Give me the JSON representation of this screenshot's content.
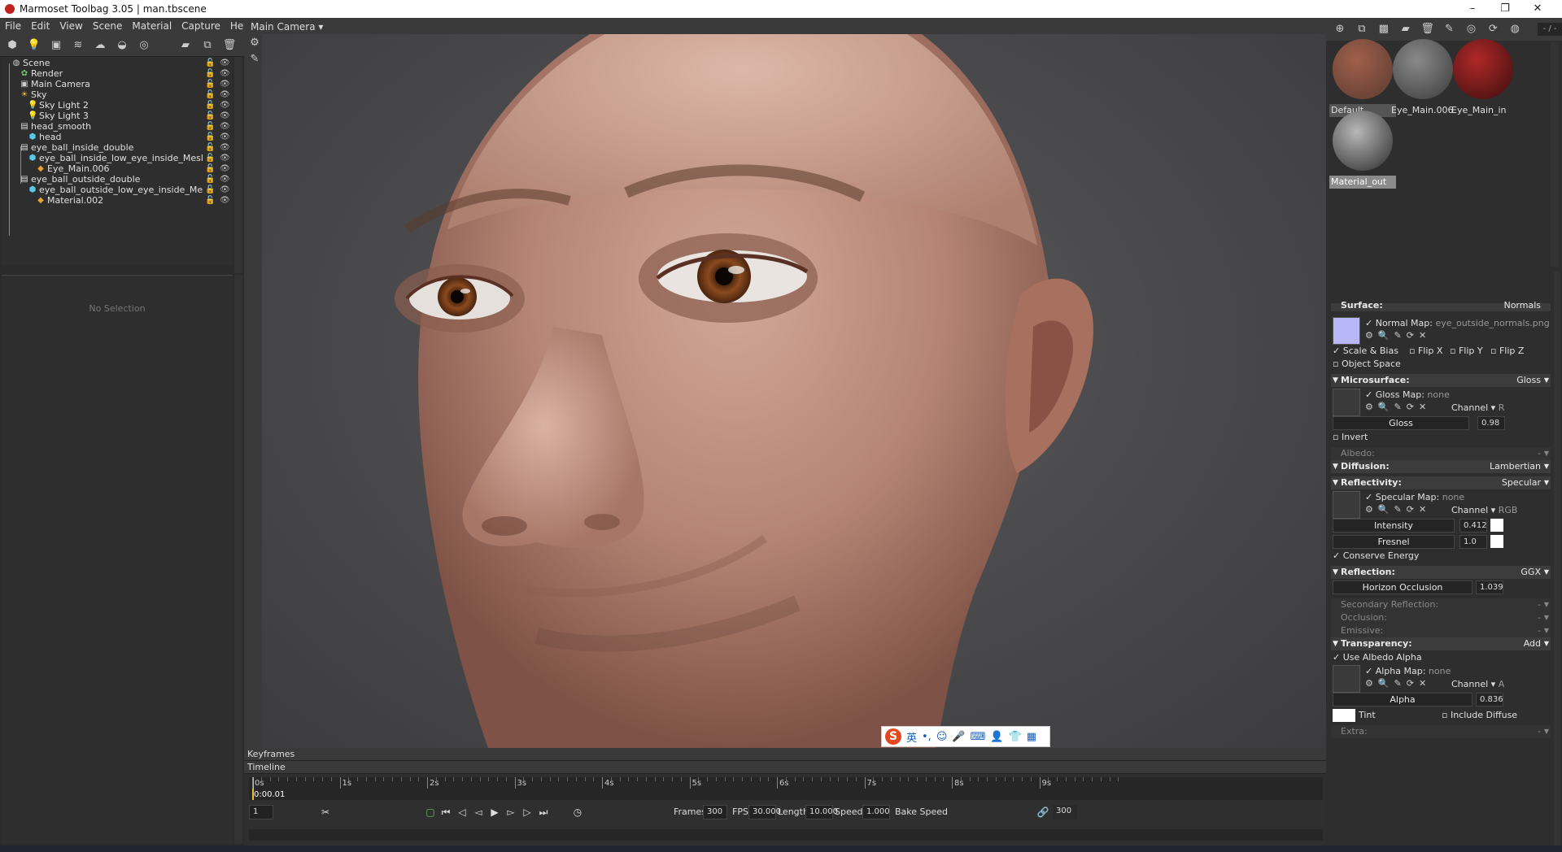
{
  "window": {
    "app_title": "Marmoset Toolbag 3.05  |  man.tbscene",
    "controls": [
      "–",
      "❐",
      "✕"
    ]
  },
  "menu": [
    "File",
    "Edit",
    "View",
    "Scene",
    "Material",
    "Capture",
    "Help"
  ],
  "scene_tree": [
    {
      "label": "Scene",
      "icon": "scene-icon",
      "depth": 0
    },
    {
      "label": "Render",
      "icon": "render-icon",
      "depth": 1
    },
    {
      "label": "Main Camera",
      "icon": "camera-icon",
      "depth": 1
    },
    {
      "label": "Sky",
      "icon": "sky-icon",
      "depth": 1
    },
    {
      "label": "Sky Light 2",
      "icon": "light-icon",
      "depth": 2
    },
    {
      "label": "Sky Light 3",
      "icon": "light-icon",
      "depth": 2
    },
    {
      "label": "head_smooth",
      "icon": "object-icon",
      "depth": 1
    },
    {
      "label": "head",
      "icon": "mesh-icon",
      "depth": 2
    },
    {
      "label": "eye_ball_inside_double",
      "icon": "object-icon",
      "depth": 1
    },
    {
      "label": "eye_ball_inside_low_eye_inside_Mesl",
      "icon": "mesh-icon",
      "depth": 2
    },
    {
      "label": "Eye_Main.006",
      "icon": "material-icon",
      "depth": 3
    },
    {
      "label": "eye_ball_outside_double",
      "icon": "object-icon",
      "depth": 1
    },
    {
      "label": "eye_ball_outside_low_eye_inside_Me",
      "icon": "mesh-icon",
      "depth": 2
    },
    {
      "label": "Material.002",
      "icon": "material-icon",
      "depth": 3
    }
  ],
  "left_panel": {
    "no_selection": "No Selection"
  },
  "viewport": {
    "camera_label": "Main Camera ▾"
  },
  "timeline": {
    "keyframes_label": "Keyframes",
    "timeline_label": "Timeline",
    "ticks": [
      "0s",
      "1s",
      "2s",
      "3s",
      "4s",
      "5s",
      "6s",
      "7s",
      "8s",
      "9s"
    ],
    "current_time": "0:00.01",
    "frame_field": "1",
    "frames_label": "Frames",
    "frames_value": "300",
    "fps_label": "FPS",
    "fps_value": "30.000",
    "length_label": "Length",
    "length_value": "10.000",
    "speed_label": "Speed",
    "speed_value": "1.000",
    "bake_speed": "Bake Speed",
    "end_frame": "300"
  },
  "right_panel": {
    "page_indicator": "- / -",
    "materials": [
      {
        "label": "Default",
        "colors": [
          "#a0604a",
          "#5a3a32"
        ]
      },
      {
        "label": "Eye_Main.006",
        "colors": [
          "#8a8a8a",
          "#3a3a3a"
        ]
      },
      {
        "label": "Eye_Main_in",
        "colors": [
          "#b02828",
          "#3a0e0e"
        ]
      },
      {
        "label": "Material_out",
        "colors": [
          "#b8b8b8",
          "#2a2a2a"
        ]
      }
    ],
    "sections": {
      "surface": {
        "name": "Surface:",
        "value": "Normals"
      },
      "normal_map_label": "Normal Map:",
      "normal_map_value": "eye_outside_normals.png",
      "scale_bias": "Scale & Bias",
      "flip_x": "Flip X",
      "flip_y": "Flip Y",
      "flip_z": "Flip Z",
      "object_space": "Object Space",
      "microsurface": {
        "name": "Microsurface:",
        "value": "Gloss"
      },
      "gloss_map_label": "Gloss Map:",
      "gloss_map_value": "none",
      "channel_label": "Channel ▾",
      "gloss_channel": "R",
      "gloss_label": "Gloss",
      "gloss_value": "0.98",
      "invert": "Invert",
      "albedo": {
        "name": "Albedo:",
        "value": "-"
      },
      "diffusion": {
        "name": "Diffusion:",
        "value": "Lambertian"
      },
      "reflectivity": {
        "name": "Reflectivity:",
        "value": "Specular"
      },
      "specular_map_label": "Specular Map:",
      "specular_map_value": "none",
      "spec_channel": "RGB",
      "intensity_label": "Intensity",
      "intensity_value": "0.412",
      "fresnel_label": "Fresnel",
      "fresnel_value": "1.0",
      "conserve_energy": "Conserve Energy",
      "reflection": {
        "name": "Reflection:",
        "value": "GGX"
      },
      "horizon_label": "Horizon Occlusion",
      "horizon_value": "1.039",
      "secondary_reflection": {
        "name": "Secondary Reflection:",
        "value": "-"
      },
      "occlusion": {
        "name": "Occlusion:",
        "value": "-"
      },
      "emissive": {
        "name": "Emissive:",
        "value": "-"
      },
      "transparency": {
        "name": "Transparency:",
        "value": "Add"
      },
      "use_albedo_alpha": "Use Albedo Alpha",
      "alpha_map_label": "Alpha Map:",
      "alpha_map_value": "none",
      "alpha_channel": "A",
      "alpha_label": "Alpha",
      "alpha_value": "0.836",
      "tint_label": "Tint",
      "include_diffuse": "Include Diffuse",
      "extra": {
        "name": "Extra:",
        "value": "-"
      }
    }
  },
  "ime_bar": {
    "logo": "S",
    "lang": "英"
  },
  "colors": {
    "skin_light": "#d8b0a0",
    "skin_mid": "#b88878",
    "skin_dark": "#8a5a4c",
    "iris": "#7a3e1a"
  }
}
